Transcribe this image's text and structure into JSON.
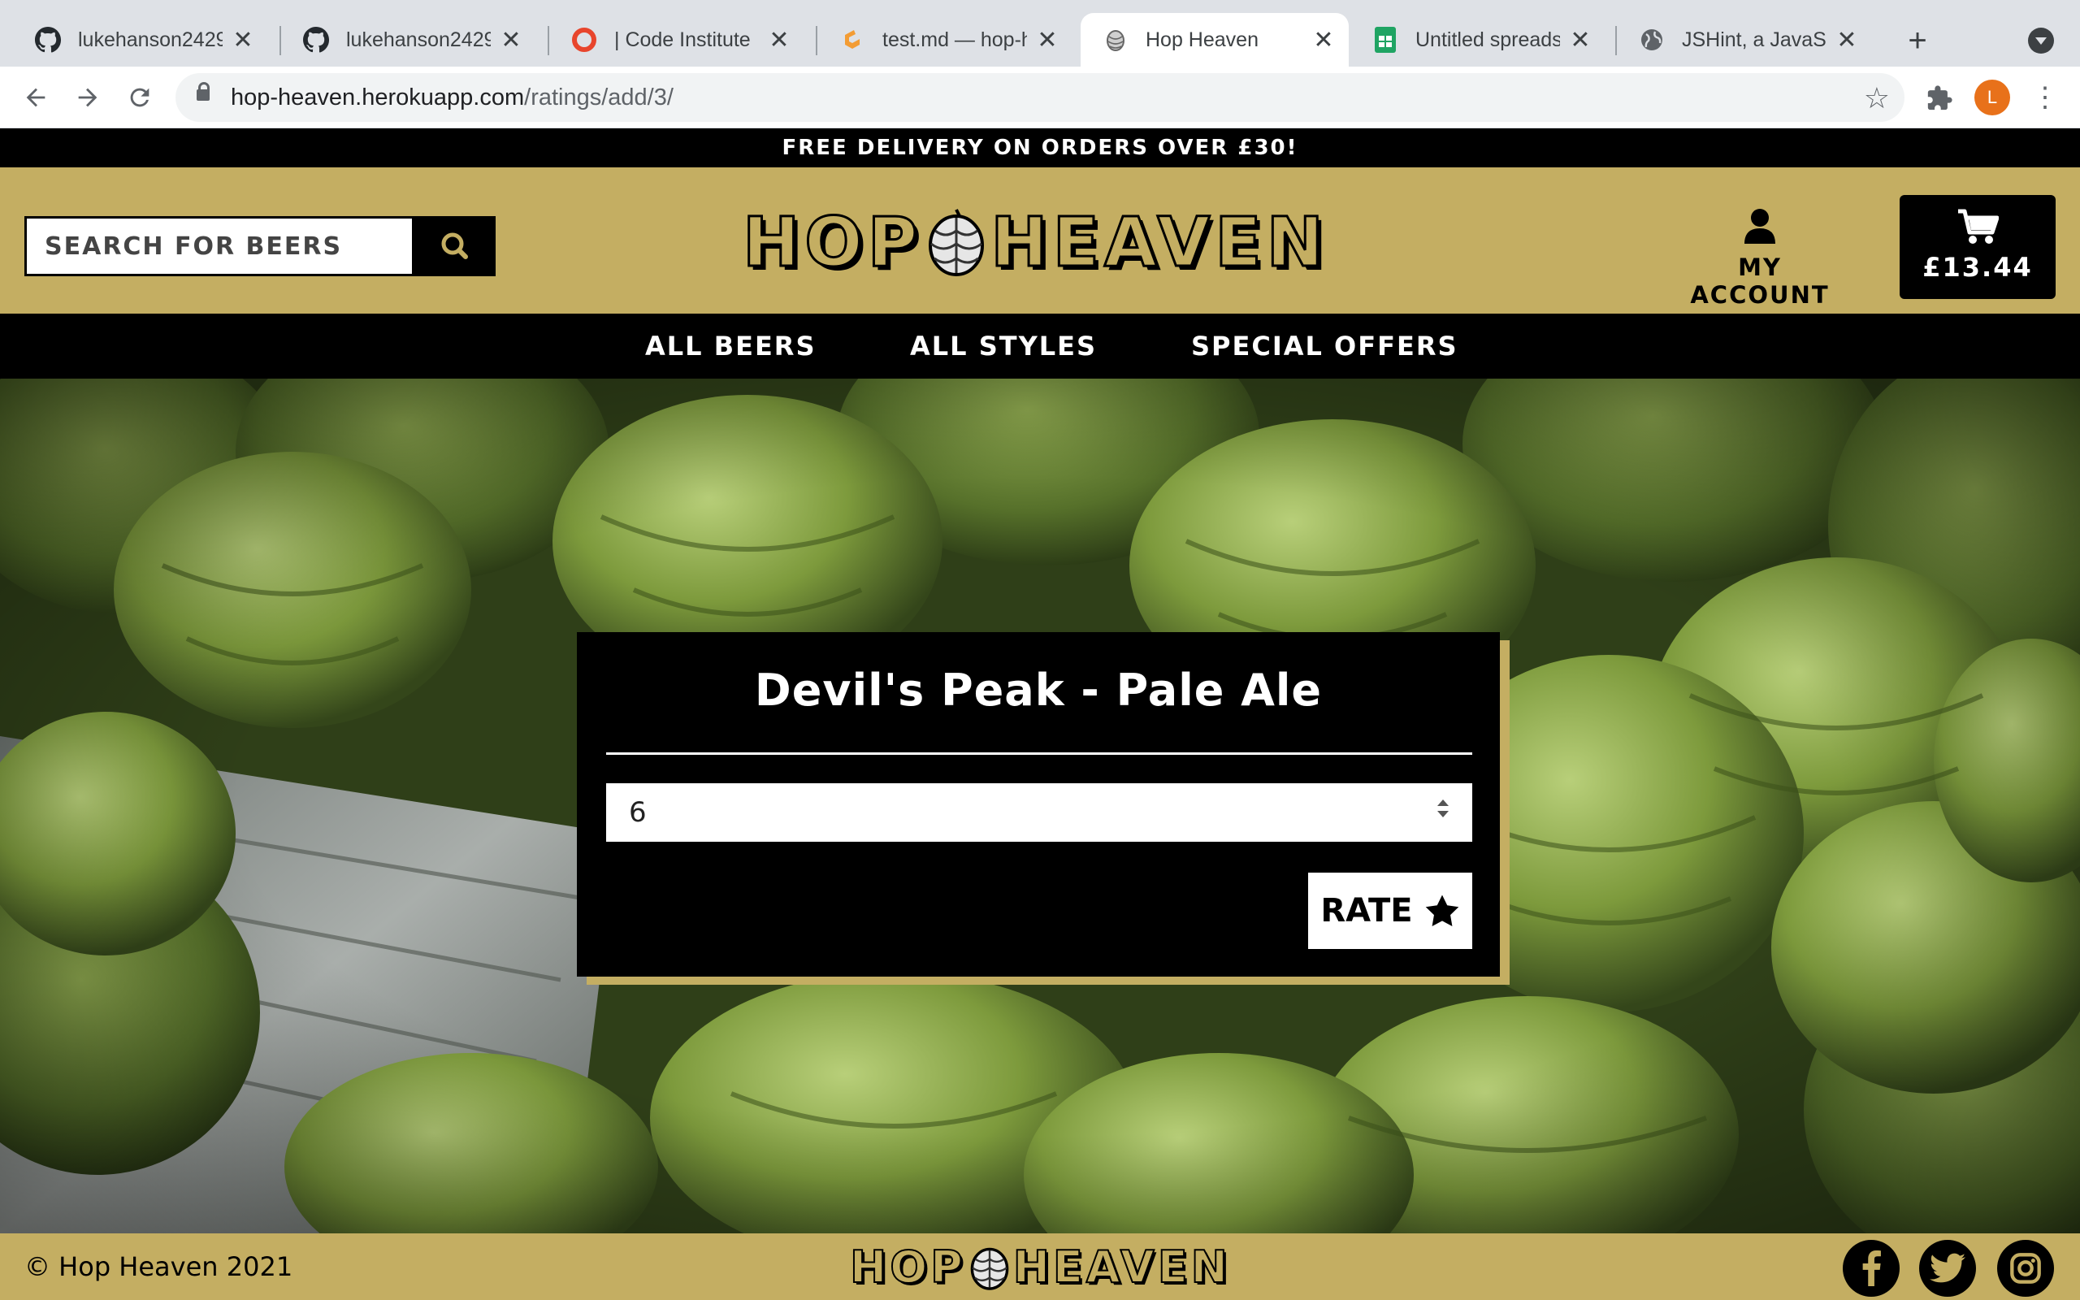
{
  "browser": {
    "tabs": [
      {
        "title": "lukehanson2429/",
        "icon": "github-icon"
      },
      {
        "title": "lukehanson2429/",
        "icon": "github-icon"
      },
      {
        "title": "| Code Institute",
        "icon": "code-institute-icon"
      },
      {
        "title": "test.md — hop-he",
        "icon": "gitpod-icon"
      },
      {
        "title": "Hop Heaven",
        "icon": "hop-icon",
        "active": true
      },
      {
        "title": "Untitled spreadsh",
        "icon": "sheets-icon"
      },
      {
        "title": "JSHint, a JavaScr",
        "icon": "globe-icon"
      }
    ],
    "url_host": "hop-heaven.herokuapp.com",
    "url_path": "/ratings/add/3/",
    "profile_initial": "L",
    "profile_color": "#e8711a"
  },
  "site": {
    "promo": "Free delivery on orders over £30!",
    "search_placeholder": "Search for beers",
    "logo_left": "HOP",
    "logo_right": "HEAVEN",
    "account_label": "My Account",
    "cart_total": "£13.44",
    "nav": [
      "All Beers",
      "All Styles",
      "Special Offers"
    ],
    "brand_color": "#c4ae62"
  },
  "rating_form": {
    "title": "Devil's Peak - Pale Ale",
    "rating_value": "6",
    "submit_label": "RATE"
  },
  "footer": {
    "copyright": "© Hop Heaven 2021",
    "social": [
      "facebook-icon",
      "twitter-icon",
      "instagram-icon"
    ]
  }
}
